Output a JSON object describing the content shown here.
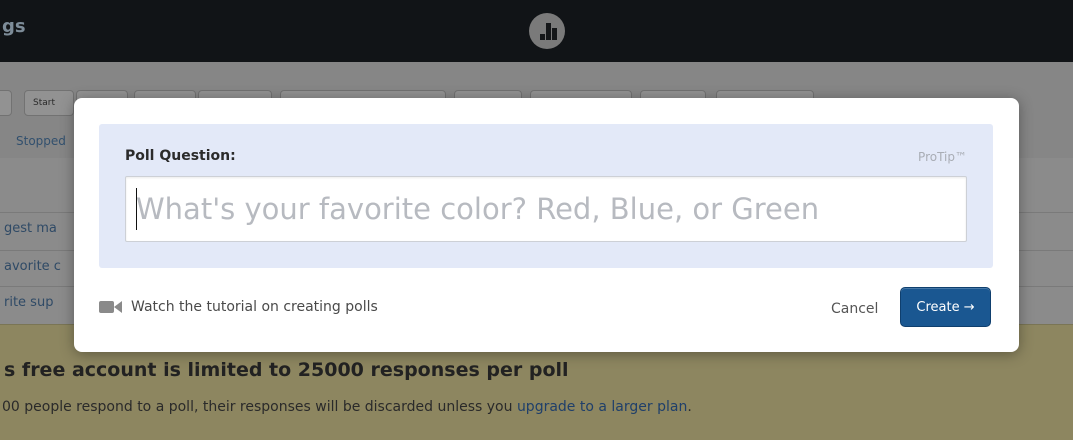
{
  "app": {
    "title_fragment": "gs",
    "logo": "bar-chart-logo"
  },
  "toolbar": {
    "start_label": "Start",
    "status_filter": "Stopped"
  },
  "poll_list": {
    "items": [
      {
        "label": "gest ma"
      },
      {
        "label": "avorite c"
      },
      {
        "label": "rite sup"
      }
    ]
  },
  "notice": {
    "headline": "s free account is limited to 25000 responses per poll",
    "body_prefix": "00 people respond to a poll, their responses will be discarded unless you ",
    "link": "upgrade to a larger plan",
    "body_suffix": "."
  },
  "modal": {
    "question_label": "Poll Question:",
    "protip_label": "ProTip™",
    "question_placeholder": "What's your favorite color? Red, Blue, or Green",
    "question_value": "",
    "tutorial_label": "Watch the tutorial on creating polls",
    "tutorial_icon": "video-camera-icon",
    "cancel_label": "Cancel",
    "create_label": "Create →",
    "colors": {
      "create_button": "#1a5791",
      "question_panel": "#e3e9f8"
    }
  }
}
